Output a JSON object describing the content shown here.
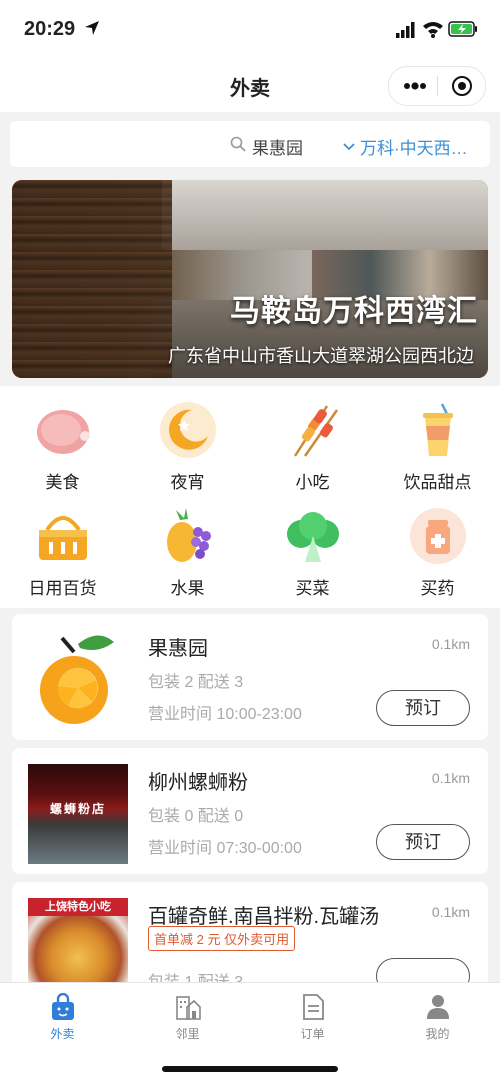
{
  "status": {
    "time": "20:29",
    "icons": [
      "location-arrow-icon",
      "signal-icon",
      "wifi-icon",
      "battery-charging-icon"
    ]
  },
  "nav": {
    "title": "外卖",
    "menu_icon": "more-dots-icon",
    "close_icon": "record-circle-icon"
  },
  "search": {
    "text": "果惠园",
    "location": "万科·中天西…"
  },
  "banner": {
    "title": "马鞍岛万科西湾汇",
    "address": "广东省中山市香山大道翠湖公园西北边"
  },
  "categories": [
    {
      "label": "美食",
      "icon": "ham-icon"
    },
    {
      "label": "夜宵",
      "icon": "moon-icon"
    },
    {
      "label": "小吃",
      "icon": "skewer-icon"
    },
    {
      "label": "饮品甜点",
      "icon": "drink-cup-icon"
    },
    {
      "label": "日用百货",
      "icon": "basket-icon"
    },
    {
      "label": "水果",
      "icon": "fruit-icon"
    },
    {
      "label": "买菜",
      "icon": "vegetable-icon"
    },
    {
      "label": "买药",
      "icon": "medicine-icon"
    }
  ],
  "stores": [
    {
      "name": "果惠园",
      "distance": "0.1km",
      "meta": "包装 2 配送 3",
      "hours": "营业时间 10:00-23:00",
      "button": "预订",
      "thumb": "orange-logo-icon"
    },
    {
      "name": "柳州螺蛳粉",
      "distance": "0.1km",
      "meta": "包装 0 配送 0",
      "hours": "营业时间 07:30-00:00",
      "button": "预订",
      "thumb_text": "螺蛳粉店"
    },
    {
      "name": "百罐奇鲜.南昌拌粉.瓦罐汤",
      "distance": "0.1km",
      "promo": "首单减 2 元 仅外卖可用",
      "meta": "包装 1 配送 3",
      "thumb_text": "上饶特色小吃"
    }
  ],
  "tabs": [
    {
      "label": "外卖",
      "icon": "shopping-bag-icon",
      "active": true
    },
    {
      "label": "邻里",
      "icon": "neighborhood-icon",
      "active": false
    },
    {
      "label": "订单",
      "icon": "order-doc-icon",
      "active": false
    },
    {
      "label": "我的",
      "icon": "profile-icon",
      "active": false
    }
  ],
  "colors": {
    "accent": "#2f7fd8",
    "location_text": "#3c8fd6",
    "promo": "#e1592e"
  }
}
